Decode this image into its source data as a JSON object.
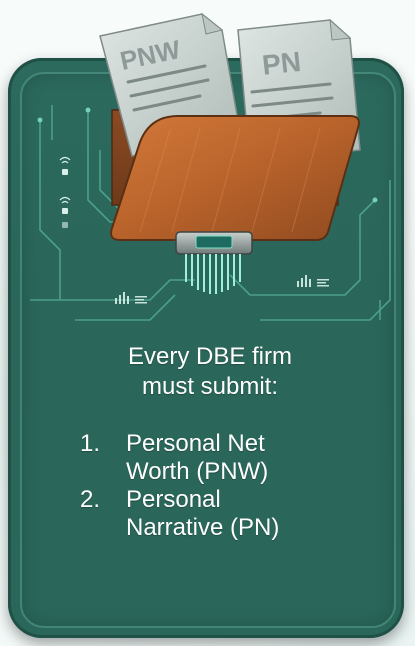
{
  "card": {
    "heading_line1": "Every DBE firm",
    "heading_line2": "must submit:",
    "items": [
      {
        "number": "1.",
        "line1": "Personal Net",
        "line2": "Worth (PNW)"
      },
      {
        "number": "2.",
        "line1": "Personal",
        "line2": "Narrative (PN)"
      }
    ]
  },
  "documents": {
    "left_label": "PNW",
    "right_label": "PN"
  },
  "colors": {
    "card": "#2a675a",
    "folder": "#b5622b",
    "paper": "#c9d3d0",
    "circuit_glow": "#7fe0c4"
  }
}
